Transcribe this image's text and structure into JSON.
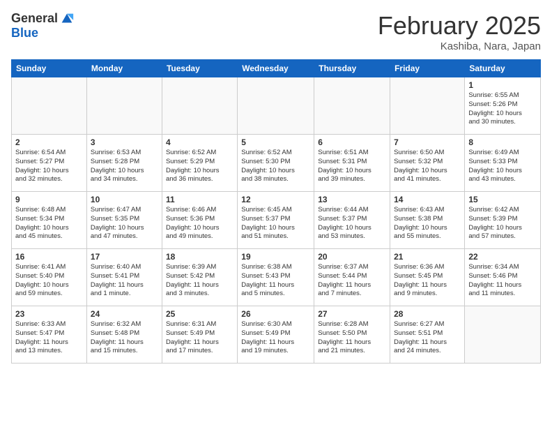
{
  "logo": {
    "general": "General",
    "blue": "Blue"
  },
  "header": {
    "title": "February 2025",
    "location": "Kashiba, Nara, Japan"
  },
  "weekdays": [
    "Sunday",
    "Monday",
    "Tuesday",
    "Wednesday",
    "Thursday",
    "Friday",
    "Saturday"
  ],
  "weeks": [
    [
      {
        "day": "",
        "info": ""
      },
      {
        "day": "",
        "info": ""
      },
      {
        "day": "",
        "info": ""
      },
      {
        "day": "",
        "info": ""
      },
      {
        "day": "",
        "info": ""
      },
      {
        "day": "",
        "info": ""
      },
      {
        "day": "1",
        "info": "Sunrise: 6:55 AM\nSunset: 5:26 PM\nDaylight: 10 hours\nand 30 minutes."
      }
    ],
    [
      {
        "day": "2",
        "info": "Sunrise: 6:54 AM\nSunset: 5:27 PM\nDaylight: 10 hours\nand 32 minutes."
      },
      {
        "day": "3",
        "info": "Sunrise: 6:53 AM\nSunset: 5:28 PM\nDaylight: 10 hours\nand 34 minutes."
      },
      {
        "day": "4",
        "info": "Sunrise: 6:52 AM\nSunset: 5:29 PM\nDaylight: 10 hours\nand 36 minutes."
      },
      {
        "day": "5",
        "info": "Sunrise: 6:52 AM\nSunset: 5:30 PM\nDaylight: 10 hours\nand 38 minutes."
      },
      {
        "day": "6",
        "info": "Sunrise: 6:51 AM\nSunset: 5:31 PM\nDaylight: 10 hours\nand 39 minutes."
      },
      {
        "day": "7",
        "info": "Sunrise: 6:50 AM\nSunset: 5:32 PM\nDaylight: 10 hours\nand 41 minutes."
      },
      {
        "day": "8",
        "info": "Sunrise: 6:49 AM\nSunset: 5:33 PM\nDaylight: 10 hours\nand 43 minutes."
      }
    ],
    [
      {
        "day": "9",
        "info": "Sunrise: 6:48 AM\nSunset: 5:34 PM\nDaylight: 10 hours\nand 45 minutes."
      },
      {
        "day": "10",
        "info": "Sunrise: 6:47 AM\nSunset: 5:35 PM\nDaylight: 10 hours\nand 47 minutes."
      },
      {
        "day": "11",
        "info": "Sunrise: 6:46 AM\nSunset: 5:36 PM\nDaylight: 10 hours\nand 49 minutes."
      },
      {
        "day": "12",
        "info": "Sunrise: 6:45 AM\nSunset: 5:37 PM\nDaylight: 10 hours\nand 51 minutes."
      },
      {
        "day": "13",
        "info": "Sunrise: 6:44 AM\nSunset: 5:37 PM\nDaylight: 10 hours\nand 53 minutes."
      },
      {
        "day": "14",
        "info": "Sunrise: 6:43 AM\nSunset: 5:38 PM\nDaylight: 10 hours\nand 55 minutes."
      },
      {
        "day": "15",
        "info": "Sunrise: 6:42 AM\nSunset: 5:39 PM\nDaylight: 10 hours\nand 57 minutes."
      }
    ],
    [
      {
        "day": "16",
        "info": "Sunrise: 6:41 AM\nSunset: 5:40 PM\nDaylight: 10 hours\nand 59 minutes."
      },
      {
        "day": "17",
        "info": "Sunrise: 6:40 AM\nSunset: 5:41 PM\nDaylight: 11 hours\nand 1 minute."
      },
      {
        "day": "18",
        "info": "Sunrise: 6:39 AM\nSunset: 5:42 PM\nDaylight: 11 hours\nand 3 minutes."
      },
      {
        "day": "19",
        "info": "Sunrise: 6:38 AM\nSunset: 5:43 PM\nDaylight: 11 hours\nand 5 minutes."
      },
      {
        "day": "20",
        "info": "Sunrise: 6:37 AM\nSunset: 5:44 PM\nDaylight: 11 hours\nand 7 minutes."
      },
      {
        "day": "21",
        "info": "Sunrise: 6:36 AM\nSunset: 5:45 PM\nDaylight: 11 hours\nand 9 minutes."
      },
      {
        "day": "22",
        "info": "Sunrise: 6:34 AM\nSunset: 5:46 PM\nDaylight: 11 hours\nand 11 minutes."
      }
    ],
    [
      {
        "day": "23",
        "info": "Sunrise: 6:33 AM\nSunset: 5:47 PM\nDaylight: 11 hours\nand 13 minutes."
      },
      {
        "day": "24",
        "info": "Sunrise: 6:32 AM\nSunset: 5:48 PM\nDaylight: 11 hours\nand 15 minutes."
      },
      {
        "day": "25",
        "info": "Sunrise: 6:31 AM\nSunset: 5:49 PM\nDaylight: 11 hours\nand 17 minutes."
      },
      {
        "day": "26",
        "info": "Sunrise: 6:30 AM\nSunset: 5:49 PM\nDaylight: 11 hours\nand 19 minutes."
      },
      {
        "day": "27",
        "info": "Sunrise: 6:28 AM\nSunset: 5:50 PM\nDaylight: 11 hours\nand 21 minutes."
      },
      {
        "day": "28",
        "info": "Sunrise: 6:27 AM\nSunset: 5:51 PM\nDaylight: 11 hours\nand 24 minutes."
      },
      {
        "day": "",
        "info": ""
      }
    ]
  ]
}
